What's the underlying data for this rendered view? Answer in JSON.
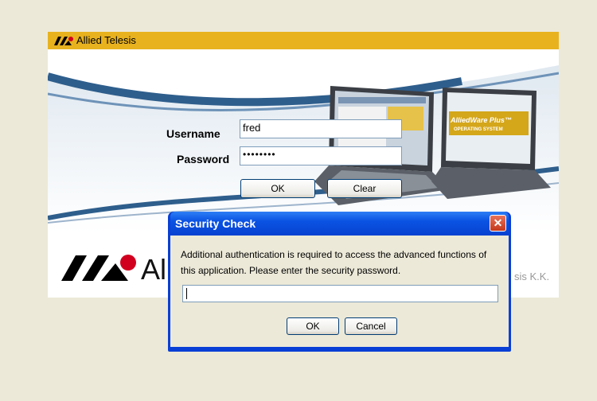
{
  "header": {
    "brand": "Allied Telesis"
  },
  "login": {
    "username_label": "Username",
    "username_value": "fred",
    "password_label": "Password",
    "password_value": "••••••••",
    "ok_label": "OK",
    "clear_label": "Clear"
  },
  "laptop_screen": {
    "line1": "AlliedWare Plus™",
    "line2": "OPERATING SYSTEM"
  },
  "footer": {
    "brand_partial": "Al",
    "copyright_partial": "sis K.K."
  },
  "dialog": {
    "title": "Security Check",
    "close_symbol": "✕",
    "message": "Additional authentication is required to access the advanced functions of this application. Please enter the security password.",
    "input_value": "",
    "ok_label": "OK",
    "cancel_label": "Cancel"
  },
  "colors": {
    "topbar": "#e8b21f",
    "dialog_title": "#0a53e3",
    "background": "#ece9d8"
  }
}
